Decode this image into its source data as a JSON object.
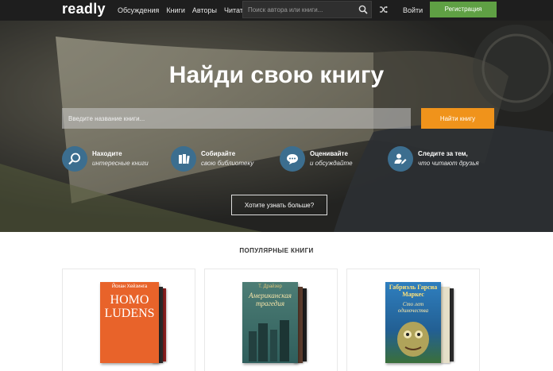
{
  "header": {
    "logo": "readly",
    "nav": [
      "Обсуждения",
      "Книги",
      "Авторы",
      "Читатели"
    ],
    "search_placeholder": "Поиск автора или книги...",
    "login": "Войти",
    "register": "Регистрация"
  },
  "hero": {
    "title": "Найди свою книгу",
    "input_placeholder": "Введите название книги...",
    "find_button": "Найти книгу",
    "features": [
      {
        "icon": "magnifier-icon",
        "title": "Находите",
        "subtitle": "интересные книги"
      },
      {
        "icon": "books-icon",
        "title": "Собирайте",
        "subtitle": "свою библиотеку"
      },
      {
        "icon": "chat-bubble-icon",
        "title": "Оценивайте",
        "subtitle": "и обсуждайте"
      },
      {
        "icon": "user-edit-icon",
        "title": "Следите за тем,",
        "subtitle": "что читают друзья"
      }
    ],
    "more_button": "Хотите узнать больше?"
  },
  "popular": {
    "title": "ПОПУЛЯРНЫЕ КНИГИ",
    "books": [
      {
        "author": "Йохан Хейзинга",
        "title": "HOMO LUDENS",
        "cover_color": "#e8632a"
      },
      {
        "author": "Т. Драйзер",
        "title": "Американская трагедия",
        "cover_color": "#3b6e6a"
      },
      {
        "author": "Габриэль Гарсиа Маркес",
        "title": "Сто лет одиночества",
        "cover_color": "#2c6fae"
      }
    ]
  },
  "colors": {
    "header_bg": "#1e1e1e",
    "register_green": "#5fa044",
    "find_orange": "#f0931b",
    "feature_blue": "#3c6e8f"
  }
}
